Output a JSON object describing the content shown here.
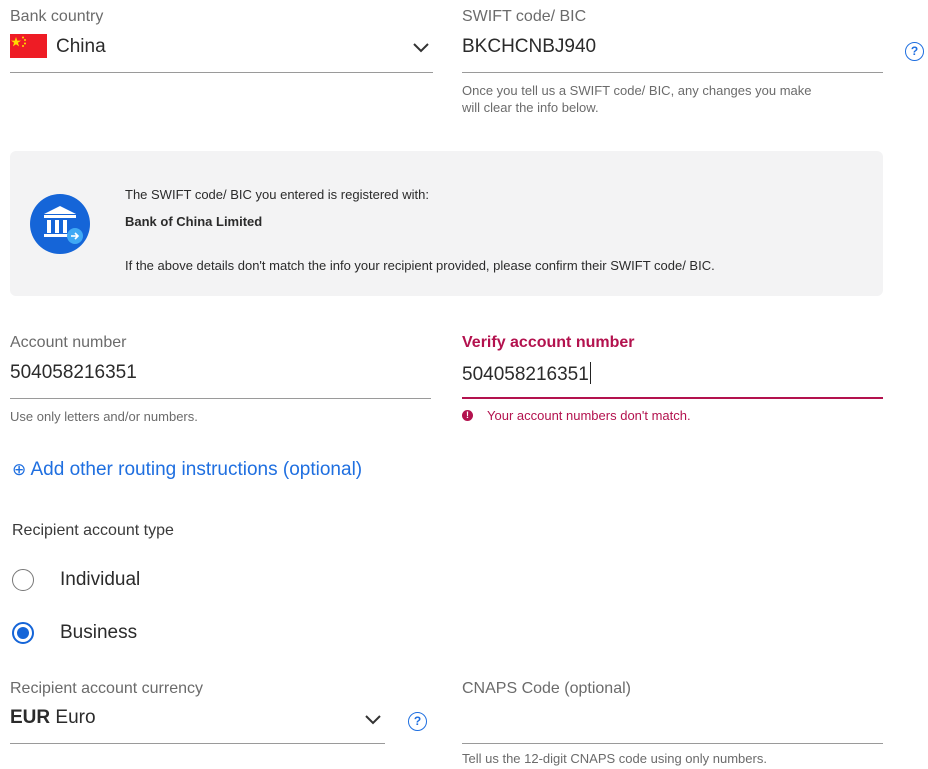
{
  "bank_country": {
    "label": "Bank country",
    "value": "China",
    "flag_colors": {
      "red": "#ee1c25",
      "star": "#ffde00"
    }
  },
  "swift": {
    "label": "SWIFT code/ BIC",
    "value": "BKCHCNBJ940",
    "help_line1": "Once you tell us a SWIFT code/ BIC, any changes you make",
    "help_line2": "will clear the info below.",
    "help_icon": "question-circle-icon"
  },
  "bank_info": {
    "registered_text": "The SWIFT code/ BIC you entered is registered with:",
    "bank_name": "Bank of China Limited",
    "mismatch_note": "If the above details don't match the info your recipient provided, please confirm their SWIFT code/ BIC.",
    "icon": "bank-building-icon"
  },
  "account_number": {
    "label": "Account number",
    "value": "504058216351",
    "help": "Use only letters and/or numbers."
  },
  "verify_account": {
    "label": "Verify account number",
    "value": "504058216351",
    "error": "Your account numbers don't match.",
    "error_color": "#b3124e"
  },
  "routing_link": {
    "icon": "⊕",
    "label": "Add other routing instructions (optional)"
  },
  "account_type": {
    "label": "Recipient account type",
    "options": [
      {
        "label": "Individual",
        "selected": false
      },
      {
        "label": "Business",
        "selected": true
      }
    ]
  },
  "currency": {
    "label": "Recipient account currency",
    "code": "EUR",
    "name": "Euro"
  },
  "cnaps": {
    "label": "CNAPS Code (optional)",
    "value": "",
    "help": "Tell us the 12-digit CNAPS code using only numbers."
  },
  "colors": {
    "accent": "#1f6fe0",
    "error": "#b3124e",
    "panel_bg": "#f3f3f4"
  }
}
